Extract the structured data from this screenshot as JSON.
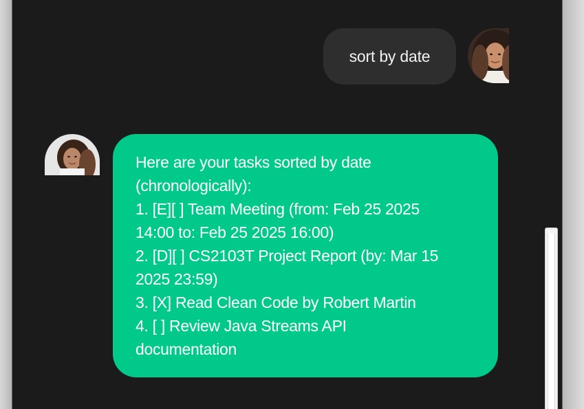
{
  "chat": {
    "user_message": "sort by date",
    "bot_lines": [
      "Here are your tasks sorted by date",
      "(chronologically):",
      "1. [E][ ] Team Meeting (from: Feb 25 2025",
      "14:00 to: Feb 25 2025 16:00)",
      "2. [D][ ] CS2103T Project Report (by: Mar 15",
      "2025 23:59)",
      "3. [X] Read Clean Code by Robert Martin",
      "4. [ ] Review Java Streams API",
      "documentation"
    ]
  },
  "colors": {
    "background": "#1b1b1b",
    "user_bubble": "#2e2e2e",
    "bot_bubble": "#00c98a",
    "text": "#ffffff"
  },
  "icons": {
    "user_avatar": "avatar-photo",
    "bot_avatar": "avatar-photo"
  }
}
